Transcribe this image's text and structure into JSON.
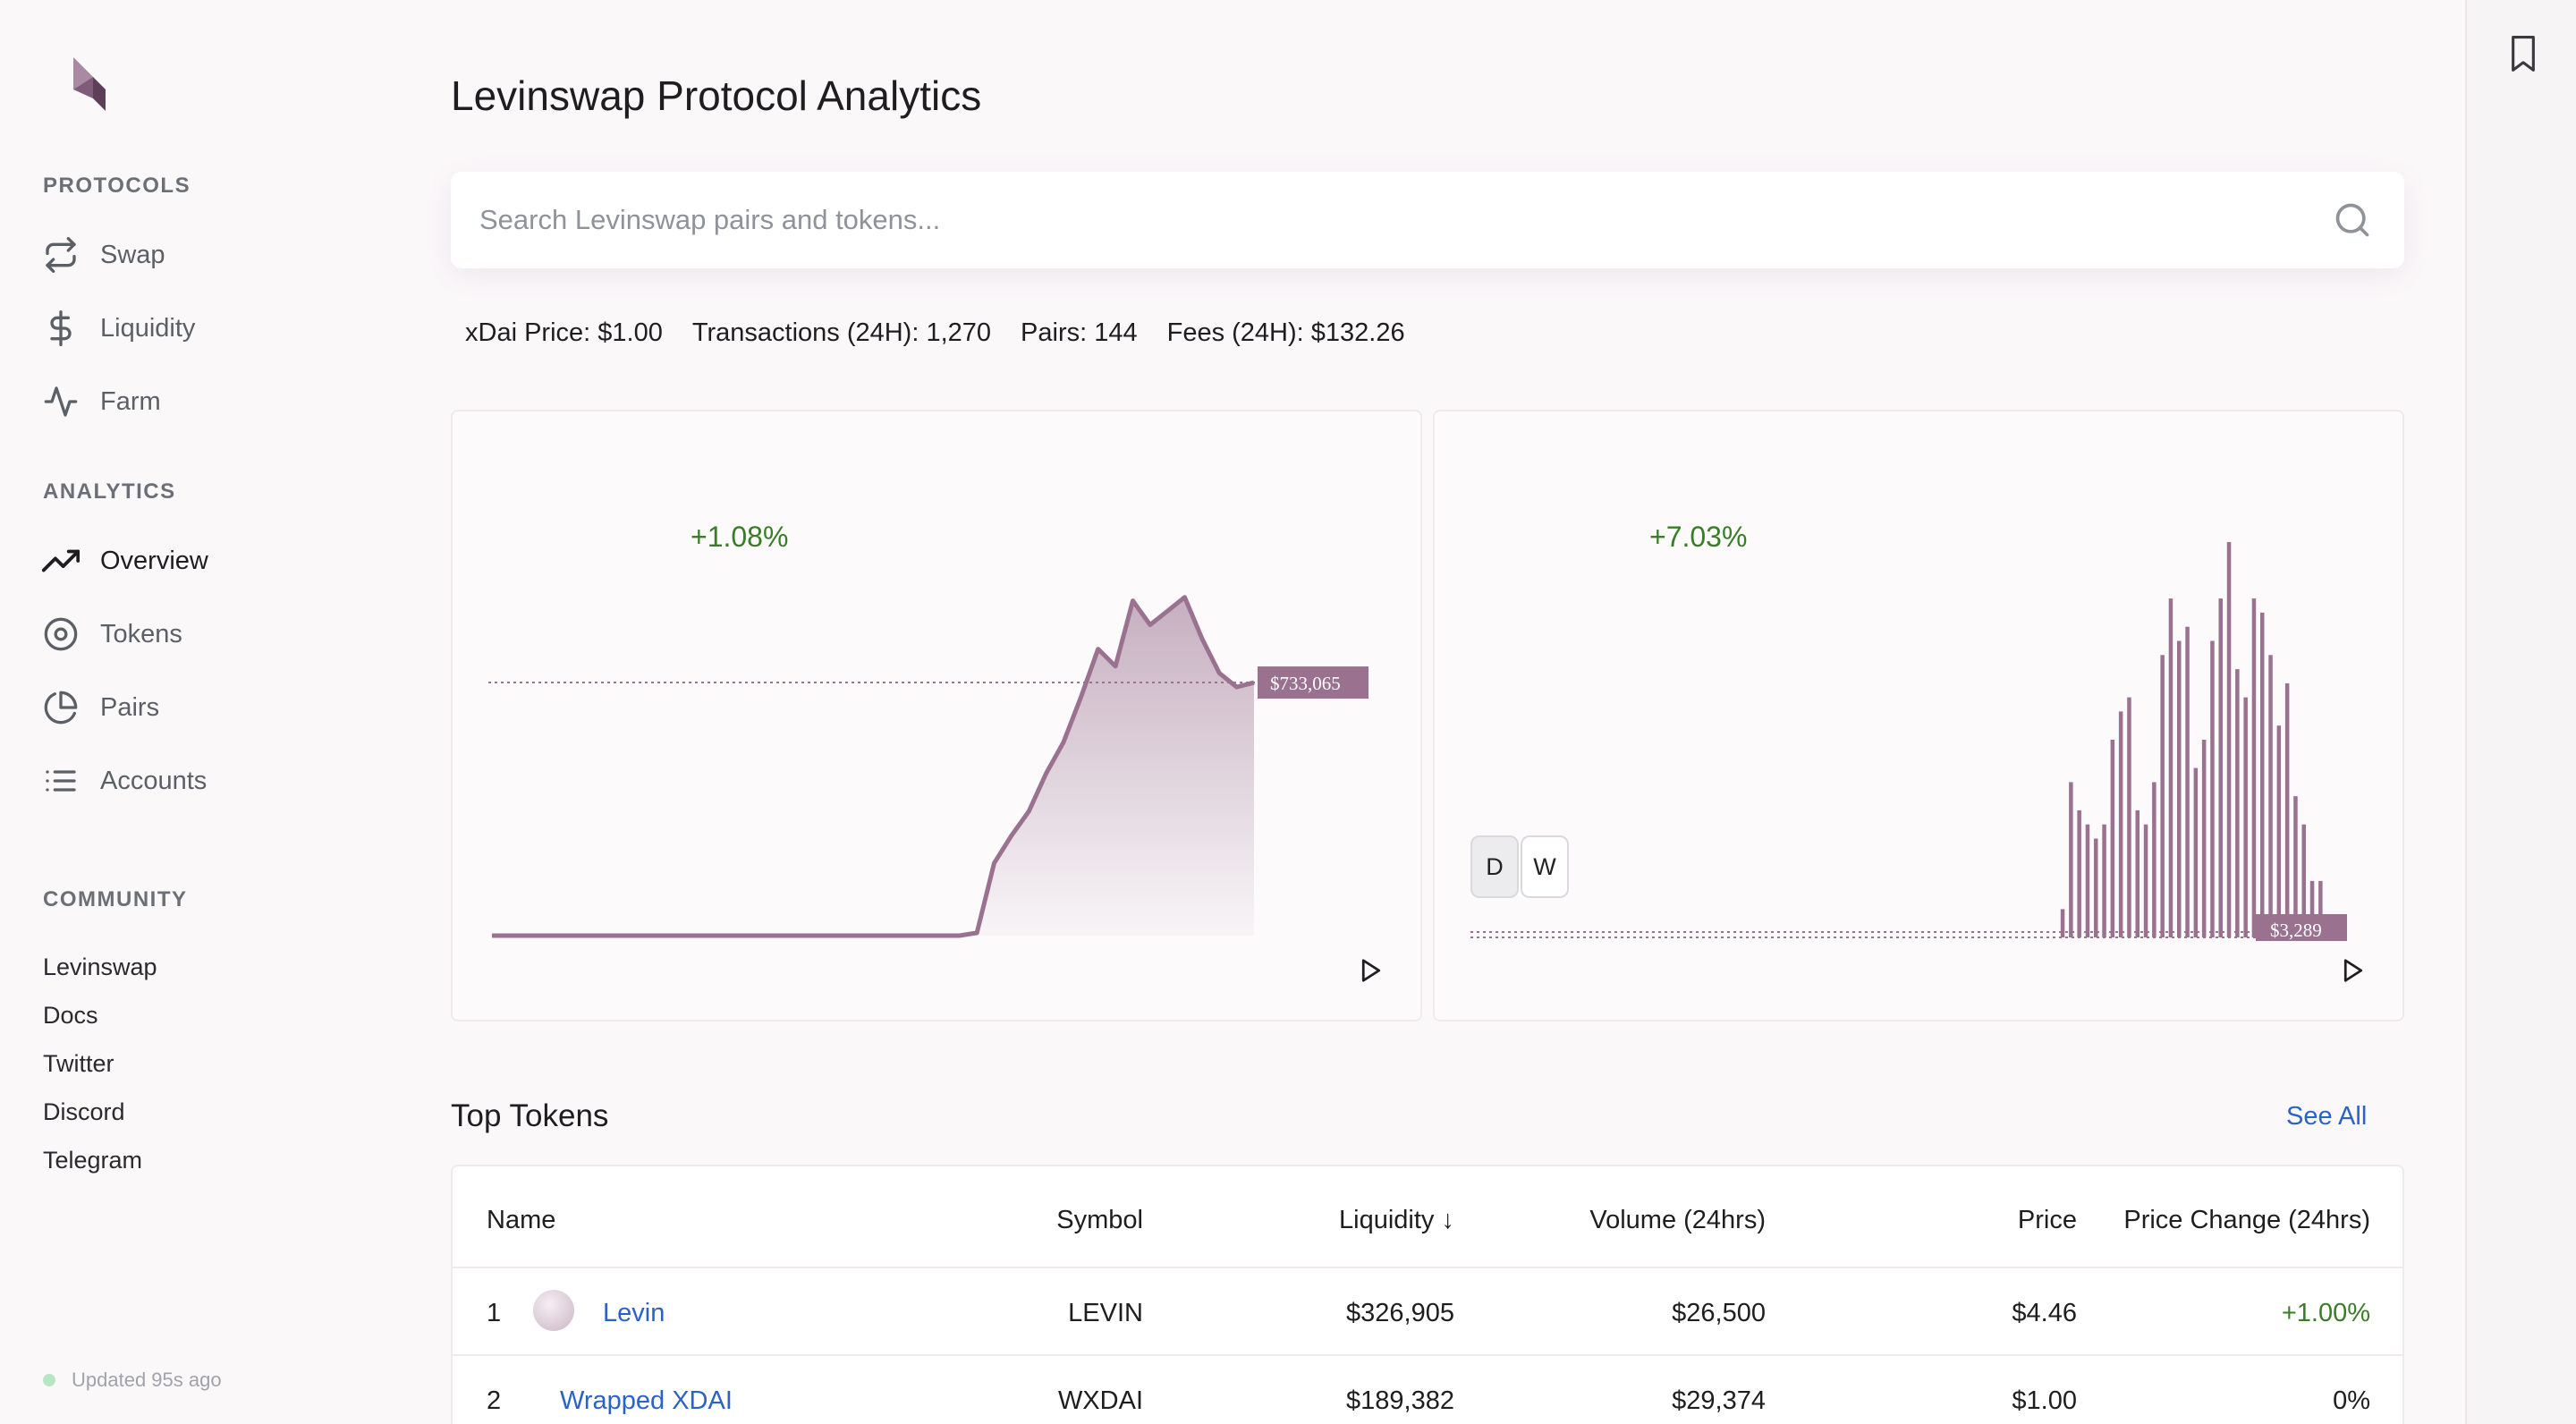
{
  "page": {
    "title": "Levinswap Protocol Analytics"
  },
  "search": {
    "placeholder": "Search Levinswap pairs and tokens..."
  },
  "sidebar": {
    "protocols_title": "PROTOCOLS",
    "protocols": [
      {
        "label": "Swap",
        "icon": "swap-arrows-icon"
      },
      {
        "label": "Liquidity",
        "icon": "dollar-icon"
      },
      {
        "label": "Farm",
        "icon": "activity-icon"
      }
    ],
    "analytics_title": "ANALYTICS",
    "analytics": [
      {
        "label": "Overview",
        "icon": "trending-up-icon",
        "active": true
      },
      {
        "label": "Tokens",
        "icon": "target-icon"
      },
      {
        "label": "Pairs",
        "icon": "pie-chart-icon"
      },
      {
        "label": "Accounts",
        "icon": "list-icon"
      }
    ],
    "community_title": "COMMUNITY",
    "community": [
      "Levinswap",
      "Docs",
      "Twitter",
      "Discord",
      "Telegram"
    ],
    "updated": "Updated 95s ago",
    "status_color": "#b8e6c5"
  },
  "stats": {
    "xdai_price": "xDai Price: $1.00",
    "transactions": "Transactions (24H): 1,270",
    "pairs": "Pairs: 144",
    "fees": "Fees (24H): $132.26"
  },
  "liquidity_card": {
    "change": "+1.08%",
    "value_label": "$733,065"
  },
  "volume_card": {
    "change": "+7.03%",
    "value_label": "$3,289",
    "buttons": [
      "D",
      "W"
    ],
    "selected": "D"
  },
  "top_tokens": {
    "title": "Top Tokens",
    "see_all": "See All",
    "columns": [
      "Name",
      "Symbol",
      "Liquidity ↓",
      "Volume (24hrs)",
      "Price",
      "Price Change (24hrs)"
    ],
    "rows": [
      {
        "rank": "1",
        "name": "Levin",
        "symbol": "LEVIN",
        "liquidity": "$326,905",
        "volume": "$26,500",
        "price": "$4.46",
        "change": "+1.00%"
      },
      {
        "rank": "2",
        "name": "Wrapped XDAI",
        "symbol": "WXDAI",
        "liquidity": "$189,382",
        "volume": "$29,374",
        "price": "$1.00",
        "change": "0%"
      }
    ]
  },
  "colors": {
    "accent": "#9a7290",
    "positive": "#3a7d28",
    "link": "#2b62c6"
  },
  "chart_data": [
    {
      "type": "area",
      "name": "Liquidity",
      "x": [
        0,
        1,
        2,
        3,
        4,
        5,
        6,
        7,
        8,
        9,
        10,
        11,
        12,
        13,
        14,
        15,
        16,
        17,
        18,
        19,
        20,
        21,
        22,
        23,
        24,
        25,
        26,
        27,
        28,
        29,
        30,
        31,
        32,
        33,
        34,
        35,
        36,
        37,
        38,
        39,
        40,
        41,
        42,
        43,
        44
      ],
      "values": [
        0,
        0,
        0,
        0,
        0,
        0,
        0,
        0,
        0,
        0,
        0,
        0,
        0,
        0,
        0,
        0,
        0,
        0,
        0,
        0,
        0,
        0,
        0,
        0,
        0,
        0,
        0,
        0,
        8,
        210,
        290,
        360,
        470,
        560,
        690,
        830,
        780,
        970,
        900,
        940,
        980,
        860,
        760,
        720,
        733
      ],
      "current": 733065
    },
    {
      "type": "bar",
      "name": "Volume",
      "values": [
        0,
        0,
        0,
        0,
        0,
        0,
        0,
        0,
        0,
        0,
        0,
        0,
        0,
        0,
        0,
        0,
        0,
        0,
        0,
        0,
        0,
        0,
        0,
        0,
        0,
        0,
        0,
        0,
        0,
        0,
        0,
        0,
        0,
        0,
        0,
        0,
        0,
        0,
        0,
        0,
        0,
        0,
        0,
        0,
        0,
        0,
        0,
        0,
        0,
        0,
        0,
        0,
        0,
        0,
        0,
        0,
        0,
        0,
        0,
        0,
        0,
        0,
        0,
        0,
        0,
        0,
        0,
        0,
        0,
        0,
        0,
        0,
        0,
        0,
        0,
        0,
        0,
        0,
        0,
        0,
        2,
        11,
        9,
        8,
        7,
        8,
        14,
        16,
        17,
        9,
        8,
        11,
        20,
        24,
        21,
        22,
        12,
        14,
        21,
        24,
        28,
        19,
        17,
        24,
        23,
        20,
        15,
        18,
        10,
        8,
        4,
        4,
        1,
        1
      ]
    }
  ]
}
